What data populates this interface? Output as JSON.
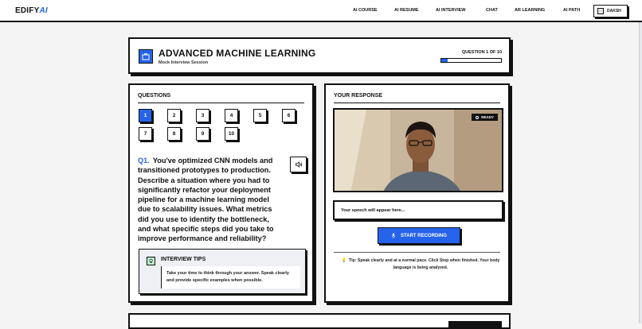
{
  "app": {
    "logo_main": "EDIFY",
    "logo_accent": "AI"
  },
  "nav": {
    "items": [
      {
        "label": "AI COURSE"
      },
      {
        "label": "AI RESUME"
      },
      {
        "label": "AI INTERVIEW"
      },
      {
        "label": "CHAT"
      },
      {
        "label": "AR LEARNING"
      },
      {
        "label": "AI PATH"
      }
    ],
    "user": "DAKSH"
  },
  "header": {
    "title": "ADVANCED MACHINE LEARNING",
    "subtitle": "Mock Interview Session",
    "question_counter": "QUESTION 1 OF 10",
    "progress": 0.1
  },
  "questions": {
    "title": "QUESTIONS",
    "numbers": [
      "1",
      "2",
      "3",
      "4",
      "5",
      "6",
      "7",
      "8",
      "9",
      "10"
    ],
    "active": "1",
    "current_number": "Q1.",
    "current_text": "You've optimized CNN models and transitioned prototypes to production. Describe a situation where you had to significantly refactor your deployment pipeline for a machine learning model due to scalability issues. What metrics did you use to identify the bottleneck, and what specific steps did you take to improve performance and reliability?"
  },
  "tips": {
    "title": "INTERVIEW TIPS",
    "body": "Take your time to think through your answer. Speak clearly and provide specific examples when possible."
  },
  "response": {
    "title": "YOUR RESPONSE",
    "video_status": "READY",
    "speech_placeholder": "Your speech will appear here...",
    "record_label": "START RECORDING",
    "tip": "Tip: Speak clearly and at a normal pace. Click Stop when finished. Your body language is being analyzed."
  },
  "colors": {
    "accent": "#2563eb",
    "ink": "#111111"
  }
}
